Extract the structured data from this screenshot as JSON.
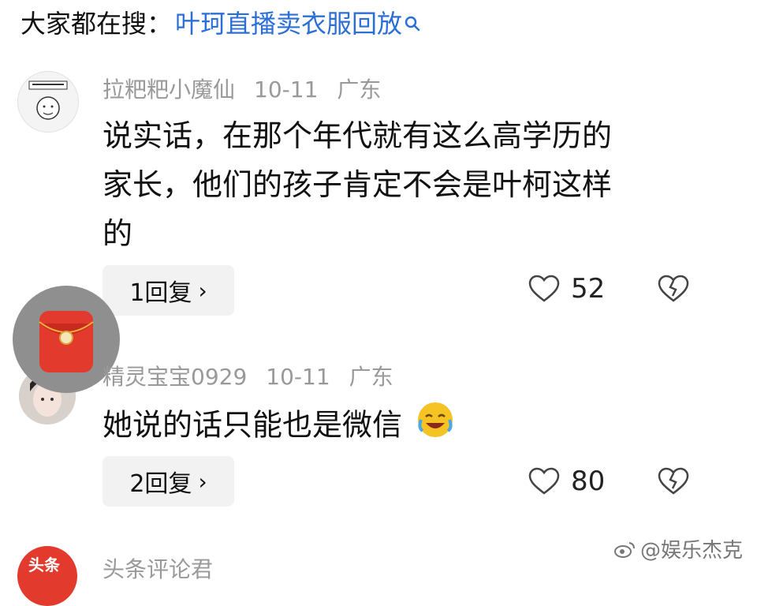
{
  "search": {
    "prefix": "大家都在搜：",
    "link": "叶珂直播卖衣服回放"
  },
  "comments": [
    {
      "username": "拉粑粑小魔仙",
      "date": "10-11",
      "location": "广东",
      "text_lines": [
        "说实话，在那个年代就有这么高学历的",
        "家长，他们的孩子肯定不会是叶柯这样",
        "的"
      ],
      "reply_label": "1回复",
      "likes": "52"
    },
    {
      "username": "精灵宝宝0929",
      "date": "10-11",
      "location": "广东",
      "text_lines": [
        "她说的话只能也是微信"
      ],
      "reply_label": "2回复",
      "likes": "80"
    },
    {
      "username": "头条评论君",
      "avatar_text": "头条"
    }
  ],
  "watermark": {
    "text": "@娱乐杰克"
  },
  "colors": {
    "link": "#2b6fd6",
    "meta": "#999999",
    "reply_bg": "#f2f2f2",
    "avatar_red": "#e23b2e"
  }
}
